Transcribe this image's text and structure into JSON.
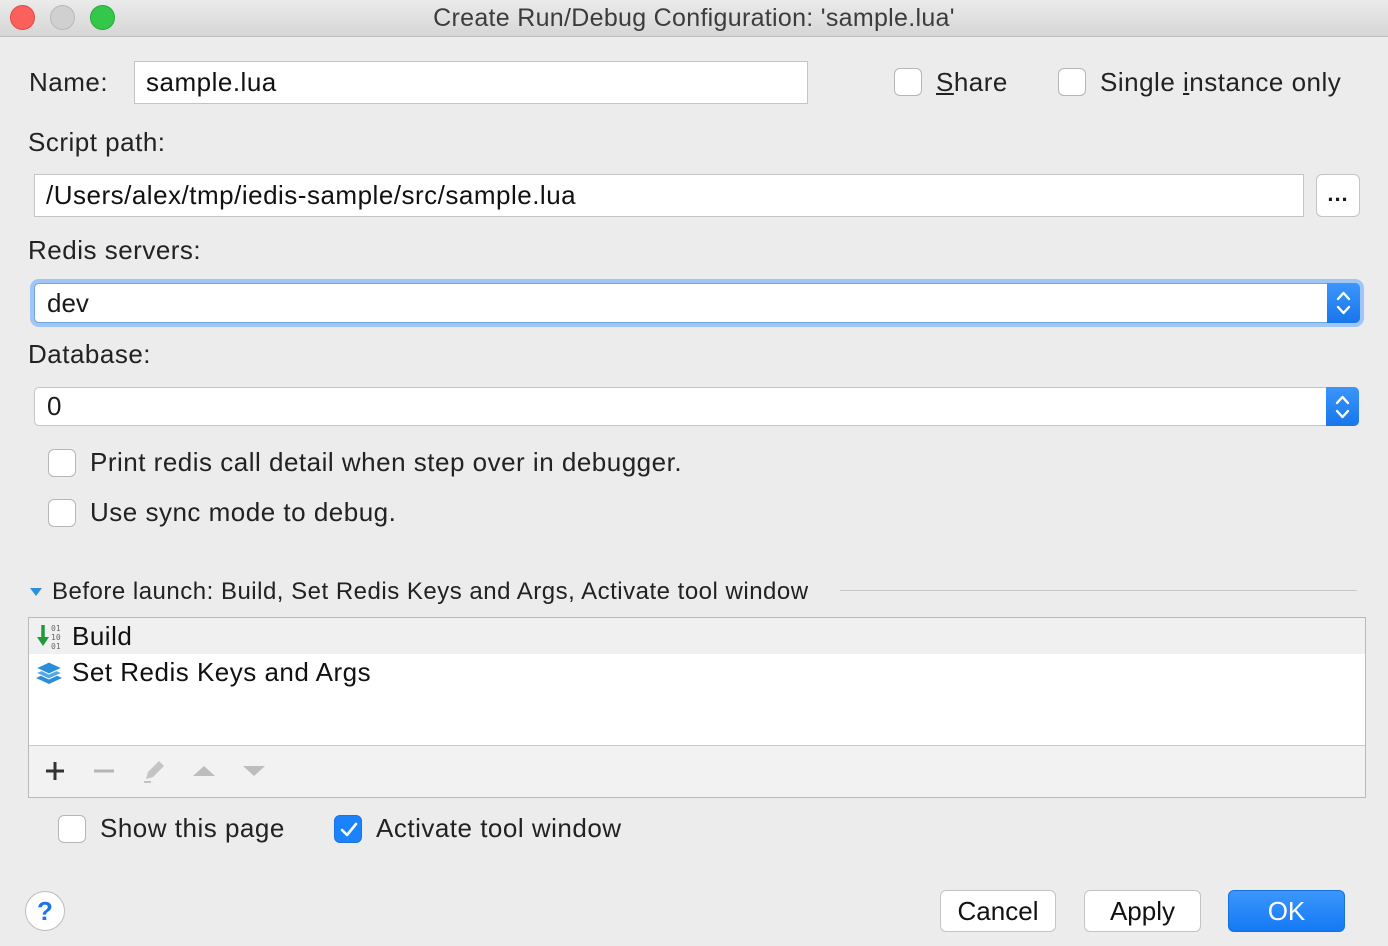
{
  "window": {
    "title": "Create Run/Debug Configuration: 'sample.lua'"
  },
  "name_field": {
    "label": "Name:",
    "value": "sample.lua"
  },
  "share": {
    "label_mnemonic": "S",
    "label_rest": "hare",
    "checked": false
  },
  "single_instance": {
    "label_pre": "Single ",
    "label_mnemonic": "i",
    "label_rest": "nstance only",
    "checked": false
  },
  "script_path": {
    "label": "Script path:",
    "value": "/Users/alex/tmp/iedis-sample/src/sample.lua",
    "browse_label": "..."
  },
  "redis_servers": {
    "label": "Redis servers:",
    "value": "dev"
  },
  "database": {
    "label": "Database:",
    "value": "0"
  },
  "options": {
    "print_detail": {
      "label": "Print redis call detail when step over in debugger.",
      "checked": false
    },
    "sync_mode": {
      "label": "Use sync mode to debug.",
      "checked": false
    }
  },
  "before_launch": {
    "header": "Before launch: Build, Set Redis Keys and Args, Activate tool window",
    "tasks": [
      {
        "label": "Build",
        "icon": "build-icon"
      },
      {
        "label": "Set Redis Keys and Args",
        "icon": "redis-stack-icon"
      }
    ],
    "toolbar": [
      "add-icon",
      "remove-icon",
      "edit-icon",
      "move-up-icon",
      "move-down-icon"
    ]
  },
  "show_page": {
    "label": "Show this page",
    "checked": false
  },
  "activate_tool_window": {
    "label": "Activate tool window",
    "checked": true
  },
  "buttons": {
    "cancel": "Cancel",
    "apply": "Apply",
    "ok": "OK",
    "help": "?"
  },
  "colors": {
    "accent": "#1a82fb",
    "close": "#fc605c",
    "maximize": "#34c84a",
    "build_arrow": "#1f9a3a",
    "redis_icon": "#2a8fd8"
  }
}
